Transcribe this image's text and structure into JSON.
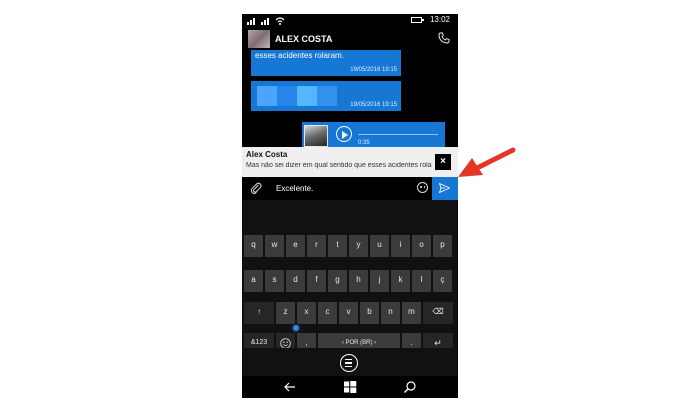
{
  "status_bar": {
    "time": "13:02"
  },
  "header": {
    "contact_name": "ALEX COSTA"
  },
  "messages": [
    {
      "text": "esses acidentes rolaram.",
      "timestamp": "19/05/2016 19:15"
    },
    {
      "timestamp": "19/05/2016 19:15"
    }
  ],
  "audio_message": {
    "duration": "0:35"
  },
  "reply": {
    "name": "Alex Costa",
    "text": "Mas não sei dizer em qual sentido que esses acidentes rolaram.",
    "close": "×"
  },
  "composer": {
    "value": "Excelente."
  },
  "keyboard": {
    "row1": [
      "q",
      "w",
      "e",
      "r",
      "t",
      "y",
      "u",
      "i",
      "o",
      "p"
    ],
    "row2": [
      "a",
      "s",
      "d",
      "f",
      "g",
      "h",
      "j",
      "k",
      "l",
      "ç"
    ],
    "row3": [
      "z",
      "x",
      "c",
      "v",
      "b",
      "n",
      "m"
    ],
    "shift": "↑",
    "backspace": "⌫",
    "numbers": "&123",
    "comma": ",",
    "space_label": "‹  POR (BR)  ›",
    "period": ".",
    "return": "↵"
  },
  "colors": {
    "accent": "#1777d4",
    "annotation": "#e53525",
    "keyboard_key": "#3b3b3b"
  },
  "icons": {
    "call": "phone-icon",
    "attach": "paperclip-icon",
    "emoji": "smiley-icon",
    "send": "send-icon",
    "menu": "keyboard-menu-icon",
    "back": "back-arrow-icon",
    "windows": "windows-icon",
    "search": "search-icon"
  }
}
